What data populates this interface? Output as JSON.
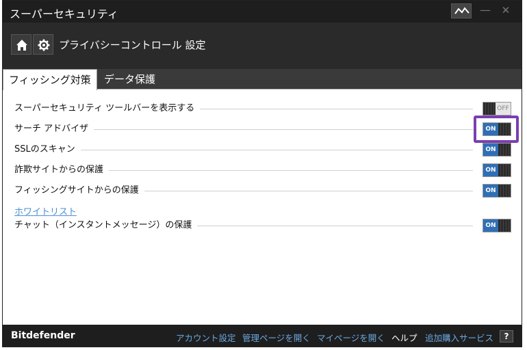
{
  "window": {
    "title": "スーパーセキュリティ"
  },
  "header": {
    "title": "プライバシーコントロール 設定"
  },
  "tabs": [
    {
      "label": "フィッシング対策",
      "active": true
    },
    {
      "label": "データ保護",
      "active": false
    }
  ],
  "settings": [
    {
      "label": "スーパーセキュリティ ツールバーを表示する",
      "state": "OFF"
    },
    {
      "label": "サーチ アドバイザ",
      "state": "ON"
    },
    {
      "label": "SSLのスキャン",
      "state": "ON"
    },
    {
      "label": "詐欺サイトからの保護",
      "state": "ON"
    },
    {
      "label": "フィッシングサイトからの保護",
      "state": "ON"
    },
    {
      "label": "チャット（インスタントメッセージ）の保護",
      "state": "ON"
    }
  ],
  "whitelist_link": "ホワイトリスト",
  "footer": {
    "brand": "Bitdefender",
    "links": [
      "アカウント設定",
      "管理ページを開く",
      "マイページを開く",
      "ヘルプ",
      "追加購入サービス"
    ],
    "help_button": "?"
  },
  "colors": {
    "toggle_on": "#2f6fb5",
    "highlight": "#7a3fb0",
    "link": "#6aa8e0"
  }
}
